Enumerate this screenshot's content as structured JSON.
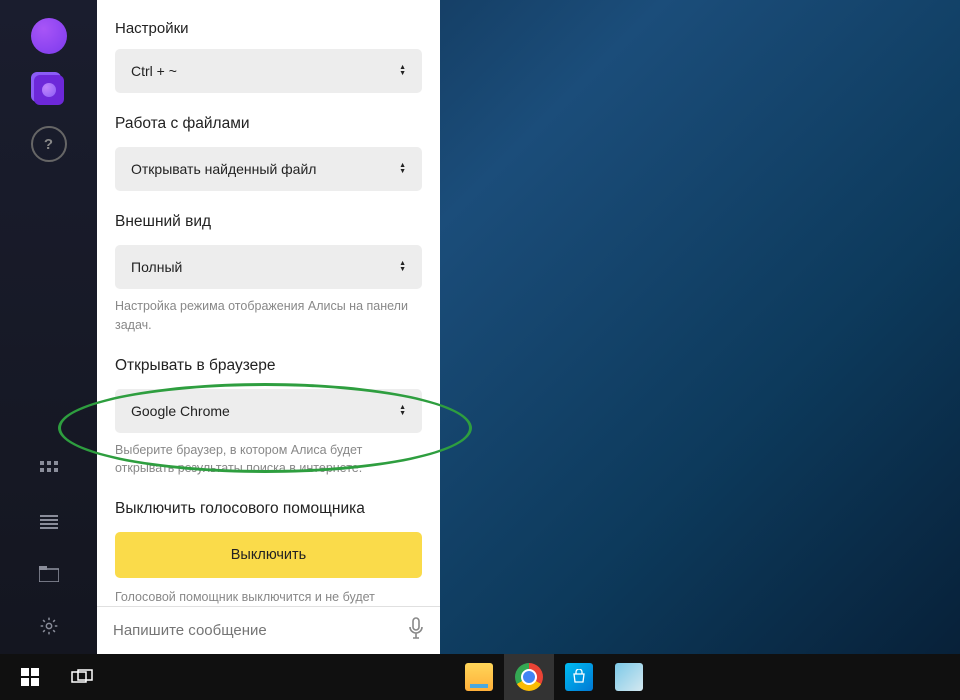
{
  "panel": {
    "title": "Настройки",
    "hotkey": {
      "value": "Ctrl + ~"
    },
    "files": {
      "label": "Работа с файлами",
      "value": "Открывать найденный файл"
    },
    "appearance": {
      "label": "Внешний вид",
      "value": "Полный",
      "hint": "Настройка режима отображения Алисы на панели задач."
    },
    "browser": {
      "label": "Открывать в браузере",
      "value": "Google Chrome",
      "hint": "Выберите браузер, в котором Алиса будет открывать результаты поиска в интернете."
    },
    "disable": {
      "label": "Выключить голосового помощника",
      "button": "Выключить",
      "hint": "Голосовой помощник выключится и не будет автоматически загружаться при включении компьютера."
    },
    "input_placeholder": "Напишите сообщение"
  }
}
